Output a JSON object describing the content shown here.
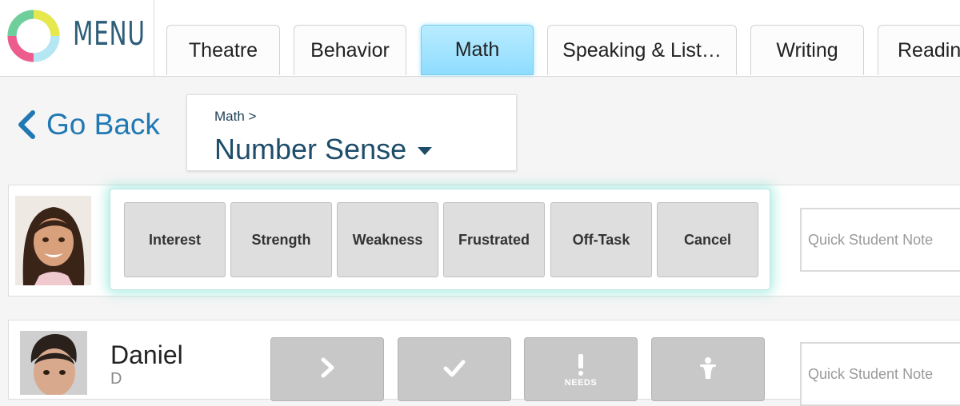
{
  "app": {
    "menu_label": "MENU"
  },
  "tabs": [
    {
      "label": "Theatre",
      "active": false
    },
    {
      "label": "Behavior",
      "active": false
    },
    {
      "label": "Math",
      "active": true
    },
    {
      "label": "Speaking & List…",
      "active": false
    },
    {
      "label": "Writing",
      "active": false
    },
    {
      "label": "Readin",
      "active": false
    }
  ],
  "nav": {
    "go_back": "Go Back"
  },
  "breadcrumb": {
    "parent": "Math >",
    "current": "Number Sense"
  },
  "tag_popup": {
    "buttons": [
      "Interest",
      "Strength",
      "Weakness",
      "Frustrated",
      "Off-Task",
      "Cancel"
    ]
  },
  "students": [
    {
      "name": "",
      "initial": "",
      "note_placeholder": "Quick Student Note"
    },
    {
      "name": "Daniel",
      "initial": "D",
      "note_placeholder": "Quick Student Note",
      "actions": [
        {
          "icon": "chevron-right-icon"
        },
        {
          "icon": "check-icon"
        },
        {
          "icon": "exclamation-icon",
          "label": "NEEDS"
        },
        {
          "icon": "person-icon"
        }
      ]
    }
  ],
  "colors": {
    "accent": "#2179b4",
    "active_tab": "#9fe2ff",
    "popup_glow": "#70e0cd"
  }
}
